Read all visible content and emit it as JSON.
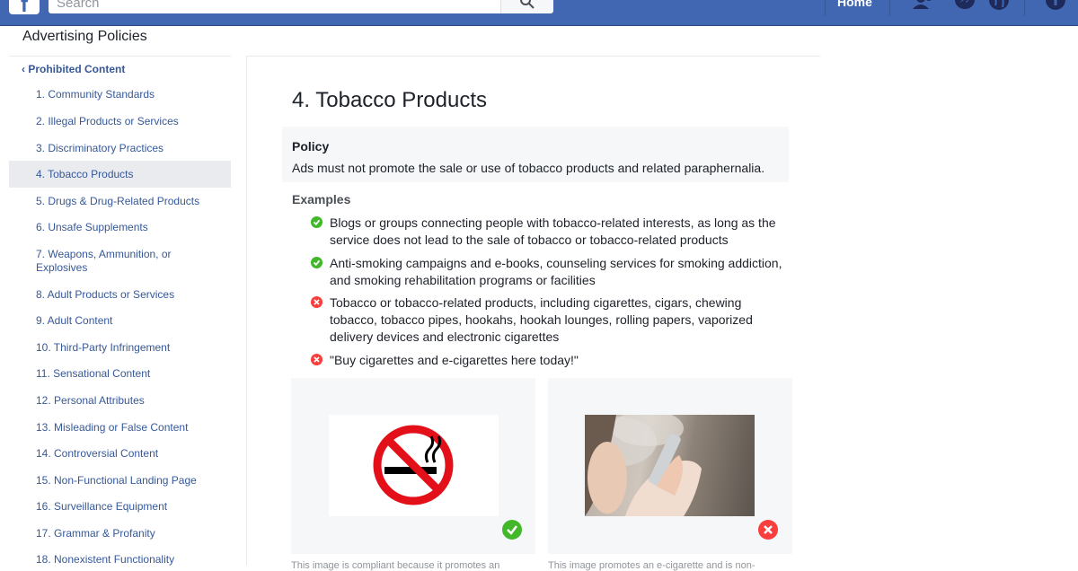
{
  "header": {
    "search_placeholder": "Search",
    "home_label": "Home"
  },
  "sidebar": {
    "title": "Advertising Policies",
    "parent": "‹ Prohibited Content",
    "items": [
      {
        "label": "1. Community Standards",
        "active": false
      },
      {
        "label": "2. Illegal Products or Services",
        "active": false
      },
      {
        "label": "3. Discriminatory Practices",
        "active": false
      },
      {
        "label": "4. Tobacco Products",
        "active": true
      },
      {
        "label": "5. Drugs & Drug-Related Products",
        "active": false
      },
      {
        "label": "6. Unsafe Supplements",
        "active": false
      },
      {
        "label": "7. Weapons, Ammunition, or",
        "label2": "Explosives",
        "active": false
      },
      {
        "label": "8. Adult Products or Services",
        "active": false
      },
      {
        "label": "9. Adult Content",
        "active": false
      },
      {
        "label": "10. Third-Party Infringement",
        "active": false
      },
      {
        "label": "11. Sensational Content",
        "active": false
      },
      {
        "label": "12. Personal Attributes",
        "active": false
      },
      {
        "label": "13. Misleading or False Content",
        "active": false
      },
      {
        "label": "14. Controversial Content",
        "active": false
      },
      {
        "label": "15. Non-Functional Landing Page",
        "active": false
      },
      {
        "label": "16. Surveillance Equipment",
        "active": false
      },
      {
        "label": "17. Grammar & Profanity",
        "active": false
      },
      {
        "label": "18. Nonexistent Functionality",
        "active": false
      }
    ]
  },
  "main": {
    "title": "4. Tobacco Products",
    "policy_heading": "Policy",
    "policy_text": "Ads must not promote the sale or use of tobacco products and related paraphernalia.",
    "examples_heading": "Examples",
    "examples": [
      {
        "allowed": true,
        "lines": [
          "Blogs or groups connecting people with tobacco-related interests, as long as the",
          "service does not lead to the sale of tobacco or tobacco-related products"
        ]
      },
      {
        "allowed": true,
        "lines": [
          "Anti-smoking campaigns and e-books, counseling services for smoking addiction,",
          "and smoking rehabilitation programs or facilities"
        ]
      },
      {
        "allowed": false,
        "lines": [
          "Tobacco or tobacco-related products, including cigarettes, cigars, chewing",
          "tobacco, tobacco pipes, hookahs, hookah lounges, rolling papers, vaporized",
          "delivery devices and electronic cigarettes"
        ]
      },
      {
        "allowed": false,
        "lines": [
          "\"Buy cigarettes and e-cigarettes here today!\""
        ]
      }
    ],
    "captions": {
      "left": "This image is compliant because it promotes an",
      "right": "This image promotes an e-cigarette and is non-"
    }
  },
  "colors": {
    "header_blue": "#4267b2",
    "link_blue": "#365899",
    "allowed_green": "#42b72a",
    "disallowed_red": "#fa3e3e",
    "panel_gray": "#f6f7f9"
  }
}
